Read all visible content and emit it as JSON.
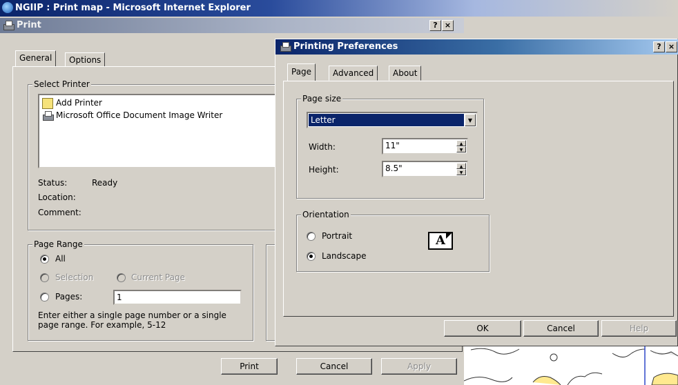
{
  "ie_window": {
    "title": "NGIIP : Print map - Microsoft Internet Explorer"
  },
  "print_dialog": {
    "title": "Print",
    "title_buttons": {
      "help": "?",
      "close": "×"
    },
    "tabs": [
      {
        "label": "General"
      },
      {
        "label": "Options"
      }
    ],
    "select_printer": {
      "label": "Select Printer",
      "printers": [
        {
          "name": "Add Printer",
          "icon": "add-printer-icon"
        },
        {
          "name": "Microsoft Office Document Image Writer",
          "icon": "printer-icon"
        }
      ]
    },
    "status": {
      "status_label": "Status:",
      "status_value": "Ready",
      "location_label": "Location:",
      "comment_label": "Comment:"
    },
    "page_range": {
      "label": "Page Range",
      "all": "All",
      "selection": "Selection",
      "current_page": "Current Page",
      "pages": "Pages:",
      "pages_value": "1",
      "hint": "Enter either a single page number or a single page range.  For example, 5-12",
      "selected": "All"
    },
    "buttons": {
      "print": "Print",
      "cancel": "Cancel",
      "apply": "Apply"
    }
  },
  "preferences_dialog": {
    "title": "Printing Preferences",
    "title_buttons": {
      "help": "?",
      "close": "×"
    },
    "tabs": [
      {
        "label": "Page"
      },
      {
        "label": "Advanced"
      },
      {
        "label": "About"
      }
    ],
    "page_size": {
      "label": "Page size",
      "selected": "Letter",
      "width_label": "Width:",
      "width_value": "11\"",
      "height_label": "Height:",
      "height_value": "8.5\""
    },
    "orientation": {
      "label": "Orientation",
      "portrait": "Portrait",
      "landscape": "Landscape",
      "selected": "Landscape",
      "preview_glyph": "A"
    },
    "buttons": {
      "ok": "OK",
      "cancel": "Cancel",
      "help": "Help"
    }
  }
}
